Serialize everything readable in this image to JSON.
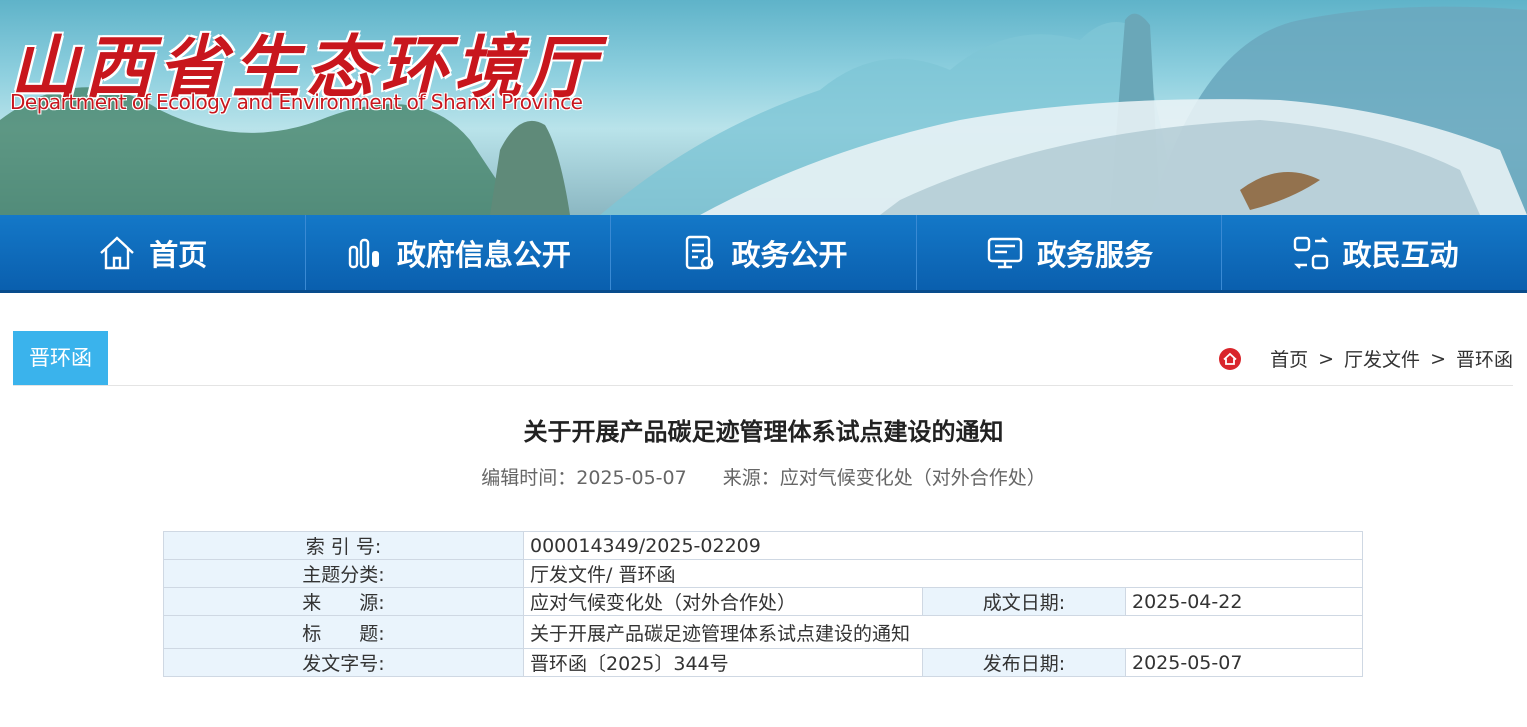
{
  "header": {
    "title_cn": "山西省生态环境厅",
    "title_en": "Department of Ecology and Environment of Shanxi Province"
  },
  "nav": {
    "items": [
      {
        "label": "首页",
        "icon": "home-icon"
      },
      {
        "label": "政府信息公开",
        "icon": "info-bars-icon"
      },
      {
        "label": "政务公开",
        "icon": "document-icon"
      },
      {
        "label": "政务服务",
        "icon": "monitor-icon"
      },
      {
        "label": "政民互动",
        "icon": "interaction-icon"
      }
    ]
  },
  "section": {
    "tag": "晋环函",
    "breadcrumb": [
      "首页",
      ">",
      "厅发文件",
      ">",
      "晋环函"
    ]
  },
  "article": {
    "title": "关于开展产品碳足迹管理体系试点建设的通知",
    "edit_time": "编辑时间：2025-05-07",
    "source": "来源：应对气候变化处（对外合作处）"
  },
  "info_table": {
    "index_label": "索 引 号:",
    "index_value": "000014349/2025-02209",
    "topic_label": "主题分类:",
    "topic_value": "厅发文件/ 晋环函",
    "source_label": "来　　源:",
    "source_value": "应对气候变化处（对外合作处）",
    "created_label": "成文日期:",
    "created_value": "2025-04-22",
    "title_label": "标　　题:",
    "title_value": "关于开展产品碳足迹管理体系试点建设的通知",
    "docno_label": "发文字号:",
    "docno_value": "晋环函〔2025〕344号",
    "published_label": "发布日期:",
    "published_value": "2025-05-07"
  },
  "colors": {
    "nav_blue": "#0a5fae",
    "tag_blue": "#3ab3ec",
    "title_red": "#c8161d",
    "label_bg": "#eaf4fc"
  }
}
